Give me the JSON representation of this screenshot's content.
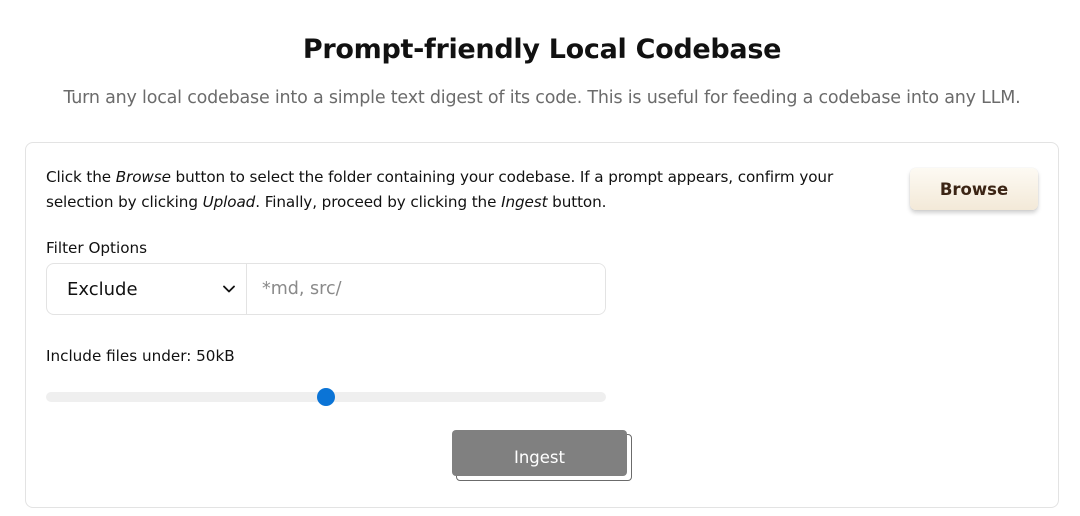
{
  "header": {
    "title": "Prompt-friendly Local Codebase",
    "subtitle": "Turn any local codebase into a simple text digest of its code. This is useful for feeding a codebase into any LLM."
  },
  "form": {
    "instructions": [
      {
        "text": "Click the ",
        "italic": false
      },
      {
        "text": "Browse",
        "italic": true
      },
      {
        "text": " button to select the folder containing your codebase. If a prompt appears, confirm your selection by clicking ",
        "italic": false
      },
      {
        "text": "Upload",
        "italic": true
      },
      {
        "text": ". Finally, proceed by clicking the ",
        "italic": false
      },
      {
        "text": "Ingest",
        "italic": true
      },
      {
        "text": " button.",
        "italic": false
      }
    ],
    "browse_label": "Browse",
    "filter_label": "Filter Options",
    "filter_mode": "Exclude",
    "filter_icon": "chevron-down-icon",
    "filter_placeholder": "*md, src/",
    "filter_value": "",
    "size_label": "Include files under: 50kB",
    "size_slider_fraction": 0.5,
    "ingest_label": "Ingest"
  },
  "colors": {
    "slider_thumb": "#0b74d6",
    "ingest_button": "#808080",
    "browse_text": "#3b2414",
    "subtitle_text": "#6b6b6b"
  }
}
